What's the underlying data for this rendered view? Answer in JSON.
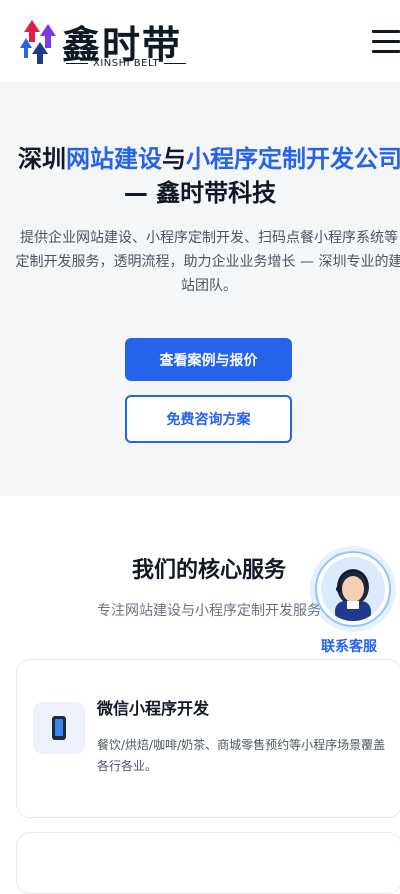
{
  "header": {
    "logo_text": "鑫时带",
    "logo_subtext": "XINSHI BELT",
    "menu_icon": "hamburger-menu-icon"
  },
  "hero": {
    "title_part1": "深圳",
    "title_hl1": "网站建设",
    "title_part2": "与",
    "title_hl2": "小程序定制开发公司",
    "title_line2": "— 鑫时带科技",
    "description": "提供企业网站建设、小程序定制开发、扫码点餐小程序系统等定制开发服务，透明流程，助力企业业务增长 — 深圳专业的建站团队。",
    "primary_button": "查看案例与报价",
    "secondary_button": "免费咨询方案"
  },
  "services": {
    "title": "我们的核心服务",
    "subtitle": "专注网站建设与小程序定制开发服务",
    "cards": [
      {
        "icon": "mobile-phone-icon",
        "title": "微信小程序开发",
        "description": "餐饮/烘焙/咖啡/奶茶、商城零售预约等小程序场景覆盖各行各业。"
      }
    ]
  },
  "customer_service": {
    "label": "联系客服",
    "icon": "customer-service-avatar"
  },
  "colors": {
    "accent": "#2563eb",
    "text_dark": "#111827",
    "hero_bg": "#f5f6f8"
  }
}
